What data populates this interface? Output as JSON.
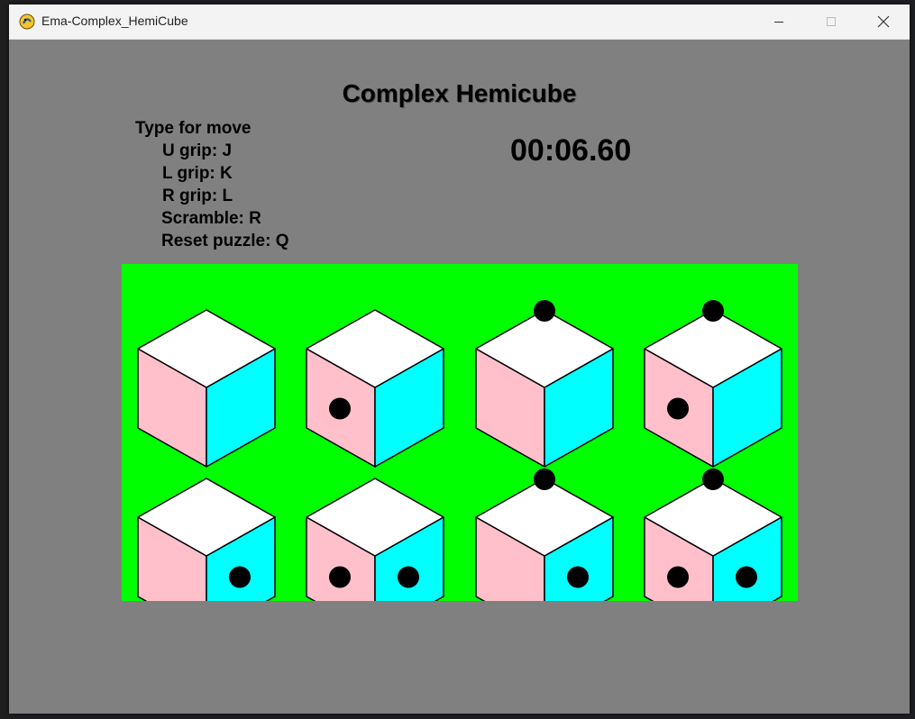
{
  "window": {
    "title": "Ema-Complex_HemiCube",
    "buttons": [
      "minimize",
      "maximize",
      "close"
    ]
  },
  "game": {
    "title": "Complex Hemicube",
    "instructions_header": "Type for move",
    "instructions": [
      "U grip: J",
      "L grip: K",
      "R grip: L",
      "Scramble: R",
      "Reset puzzle: Q"
    ],
    "timer": "00:06.60"
  },
  "colors": {
    "board": "#00ff00",
    "top_face": "#ffffff",
    "left_face": "#ffc0cb",
    "right_face": "#00ffff",
    "dot": "#000000",
    "background": "#808080"
  },
  "cubes": [
    {
      "top": false,
      "left": false,
      "right": false
    },
    {
      "top": false,
      "left": true,
      "right": false
    },
    {
      "top": true,
      "left": false,
      "right": false
    },
    {
      "top": true,
      "left": true,
      "right": false
    },
    {
      "top": false,
      "left": false,
      "right": true
    },
    {
      "top": false,
      "left": true,
      "right": true
    },
    {
      "top": true,
      "left": false,
      "right": true
    },
    {
      "top": true,
      "left": true,
      "right": true
    }
  ]
}
